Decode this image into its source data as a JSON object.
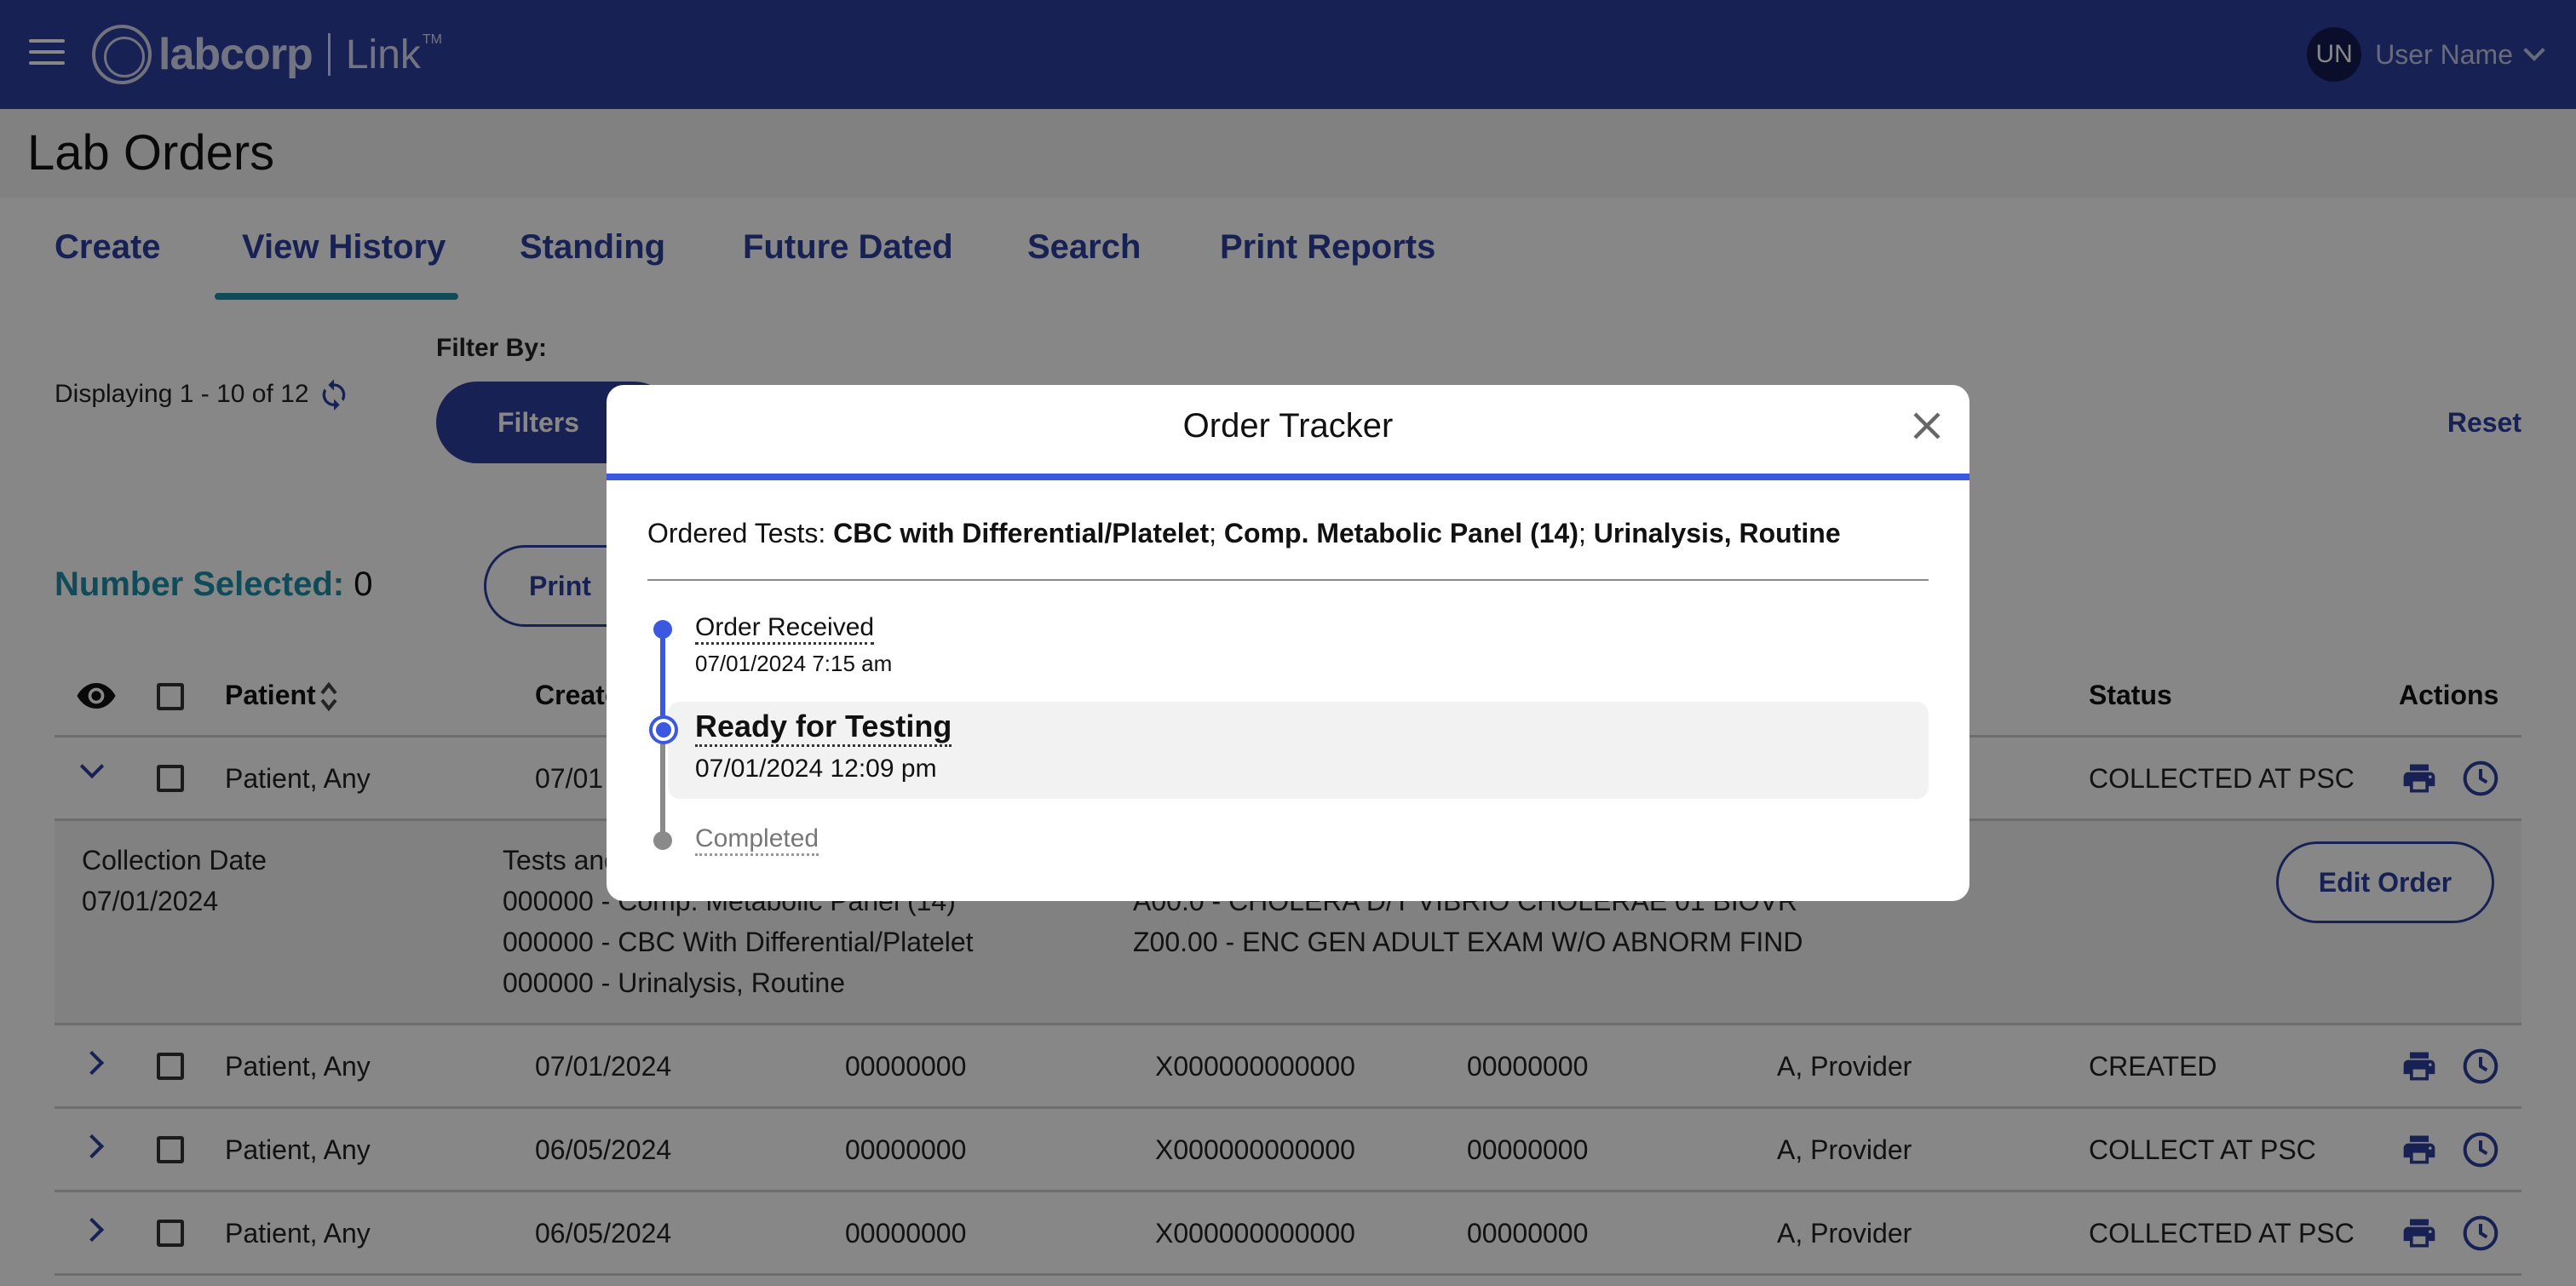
{
  "header": {
    "brand": "labcorp",
    "product": "Link",
    "trademark": "TM",
    "user_initials": "UN",
    "user_name": "User Name"
  },
  "page": {
    "title": "Lab Orders"
  },
  "tabs": [
    {
      "label": "Create"
    },
    {
      "label": "View History",
      "active": true
    },
    {
      "label": "Standing"
    },
    {
      "label": "Future Dated"
    },
    {
      "label": "Search"
    },
    {
      "label": "Print Reports"
    }
  ],
  "filter": {
    "displaying": "Displaying 1 - 10 of 12",
    "filter_by_label": "Filter By:",
    "filters_button": "Filters",
    "reset_label": "Reset"
  },
  "selection": {
    "label": "Number Selected:",
    "count": "0",
    "print_button": "Print"
  },
  "table": {
    "headers": {
      "patient": "Patient",
      "created": "Create",
      "status": "Status",
      "actions": "Actions"
    },
    "expanded_row": {
      "patient": "Patient, Any",
      "created": "07/01",
      "status": "COLLECTED AT PSC",
      "detail": {
        "collection_label": "Collection Date",
        "collection_date": "07/01/2024",
        "tests_label": "Tests and",
        "tests": [
          "000000 - Comp. Metabolic Panel (14)",
          "000000 - CBC With Differential/Platelet",
          "000000 - Urinalysis, Routine"
        ],
        "diagnoses": [
          "A00.0 - CHOLERA D/T VIBRIO CHOLERAE 01 BIOVR",
          "Z00.00 - ENC GEN ADULT EXAM W/O ABNORM FIND"
        ],
        "edit_button": "Edit Order"
      }
    },
    "rows": [
      {
        "patient": "Patient, Any",
        "created": "07/01/2024",
        "col3": "00000000",
        "col4": "X000000000000",
        "col5": "00000000",
        "provider": "A, Provider",
        "status": "CREATED"
      },
      {
        "patient": "Patient, Any",
        "created": "06/05/2024",
        "col3": "00000000",
        "col4": "X000000000000",
        "col5": "00000000",
        "provider": "A, Provider",
        "status": "COLLECT AT PSC"
      },
      {
        "patient": "Patient, Any",
        "created": "06/05/2024",
        "col3": "00000000",
        "col4": "X000000000000",
        "col5": "00000000",
        "provider": "A, Provider",
        "status": "COLLECTED AT PSC"
      }
    ]
  },
  "modal": {
    "title": "Order Tracker",
    "ordered_label": "Ordered Tests:",
    "tests": [
      "CBC with Differential/Platelet",
      "Comp. Metabolic Panel (14)",
      "Urinalysis, Routine"
    ],
    "separator": ";",
    "steps": [
      {
        "label": "Order Received",
        "date": "07/01/2024 7:15 am",
        "state": "done"
      },
      {
        "label": "Ready for Testing",
        "date": "07/01/2024 12:09 pm",
        "state": "current"
      },
      {
        "label": "Completed",
        "state": "pending"
      }
    ]
  },
  "colors": {
    "brand_blue": "#2e3f9e",
    "accent_teal": "#1f8fa8",
    "tracker_blue": "#3b58e0",
    "pending_gray": "#8a8a8a"
  },
  "icons": [
    "hamburger-icon",
    "logo-icon",
    "chevron-down-icon",
    "refresh-icon",
    "eye-icon",
    "sort-icon",
    "print-icon",
    "clock-icon",
    "close-icon"
  ]
}
